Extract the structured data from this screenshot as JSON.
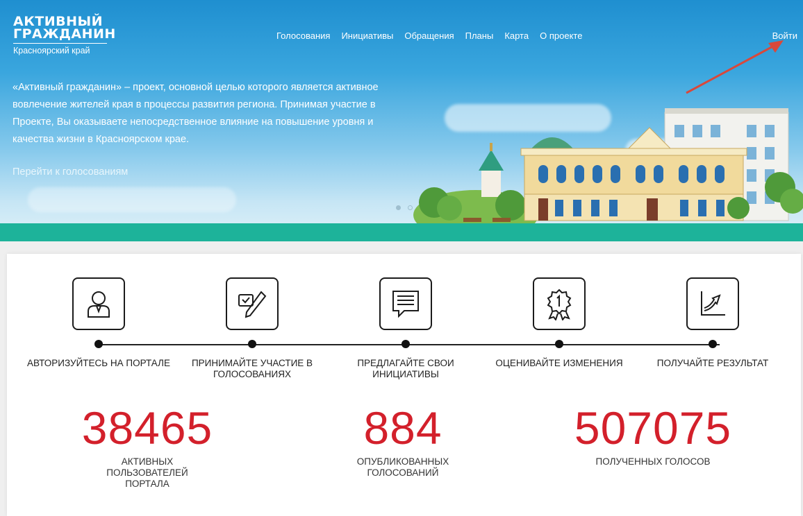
{
  "logo": {
    "line1": "АКТИВНЫЙ",
    "line2": "ГРАЖДАНИН",
    "region": "Красноярский край"
  },
  "nav": {
    "items": [
      "Голосования",
      "Инициативы",
      "Обращения",
      "Планы",
      "Карта",
      "О проекте"
    ],
    "login": "Войти"
  },
  "hero": {
    "text": "«Активный гражданин» – проект, основной целью которого является активное вовлечение жителей края в процессы развития региона. Принимая участие в Проекте, Вы оказываете непосредственное влияние на повышение уровня и качества жизни в Красноярском крае.",
    "link": "Перейти к голосованиям",
    "carousel_total": 2,
    "carousel_active": 1
  },
  "steps": [
    {
      "label": "АВТОРИЗУЙТЕСЬ НА ПОРТАЛЕ",
      "icon": "user-icon"
    },
    {
      "label": "ПРИНИМАЙТЕ УЧАСТИЕ В ГОЛОСОВАНИЯХ",
      "icon": "ballot-pen-icon"
    },
    {
      "label": "ПРЕДЛАГАЙТЕ СВОИ ИНИЦИАТИВЫ",
      "icon": "message-icon"
    },
    {
      "label": "ОЦЕНИВАЙТЕ ИЗМЕНЕНИЯ",
      "icon": "award-icon"
    },
    {
      "label": "ПОЛУЧАЙТЕ РЕЗУЛЬТАТ",
      "icon": "growth-chart-icon"
    }
  ],
  "stats": [
    {
      "value": "38465",
      "caption": "АКТИВНЫХ ПОЛЬЗОВАТЕЛЕЙ ПОРТАЛА"
    },
    {
      "value": "884",
      "caption": "ОПУБЛИКОВАННЫХ ГОЛОСОВАНИЙ"
    },
    {
      "value": "507075",
      "caption": "ПОЛУЧЕННЫХ ГОЛОСОВ"
    }
  ],
  "colors": {
    "accent_red": "#d3202b",
    "teal": "#1db39a",
    "sky": "#2a9bd8"
  }
}
